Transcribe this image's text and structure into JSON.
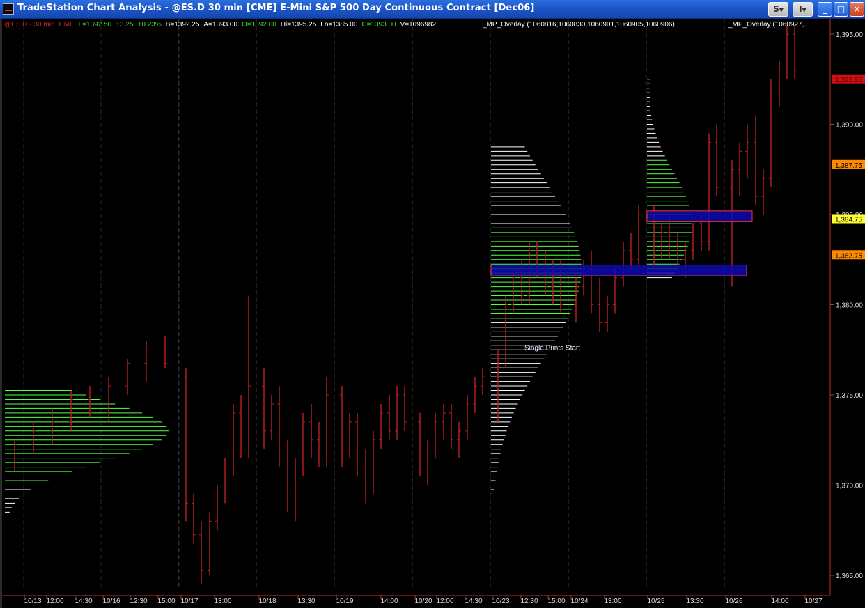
{
  "window": {
    "title": "TradeStation Chart Analysis - @ES.D  30 min  [CME] E-Mini S&P 500 Day Continuous Contract [Dec06]",
    "buttons": {
      "s_label": "S",
      "i_label": "I",
      "min": "_",
      "max": "□",
      "close": "×"
    }
  },
  "header": {
    "symbol": "@ES.D - 30 min",
    "exchange": "CME",
    "last": "L=1392.50",
    "change": "+3.25",
    "pct": "+0.23%",
    "bid": "B=1392.25",
    "ask": "A=1393.00",
    "open": "O=1392.00",
    "high": "Hi=1395.25",
    "low": "Lo=1385.00",
    "close": "C=1393.00",
    "volume": "V=1096982"
  },
  "overlays": [
    "_MP_Overlay  (1060816,1060830,1060901,1060905,1060906)",
    "_MP_Overlay  (1060927,..."
  ],
  "annotation": "Single Prints Start",
  "colors": {
    "up": "#44dd33",
    "down": "#cc2222",
    "bar": "#bb1f1f",
    "profile_green": "#55ff44",
    "profile_white": "#ffffff",
    "zone_fill": "#0b0bb0",
    "zone_border": "#ff3030",
    "axis": "#dddddd",
    "grid": "#555555"
  },
  "chart_data": {
    "type": "candlestick",
    "interval": "30 min",
    "ylim": [
      1364,
      1396
    ],
    "y_ticks": [
      "1,365.00",
      "1,370.00",
      "1,375.00",
      "1,380.00",
      "1,385.00",
      "1,390.00",
      "1,395.00"
    ],
    "x_ticks": [
      "10/13",
      "12:00",
      "14:30",
      "10/16",
      "12:30",
      "15:00",
      "10/17",
      "13:00",
      "10/18",
      "13:30",
      "10/19",
      "14:00",
      "10/20",
      "12:00",
      "14:30",
      "10/23",
      "12:30",
      "15:00",
      "10/24",
      "13:00",
      "10/25",
      "13:30",
      "10/26",
      "14:00",
      "10/27"
    ],
    "price_markers": [
      {
        "label": "1,392.50",
        "value": 1392.5,
        "bg": "#cc1111",
        "fg": "#660000"
      },
      {
        "label": "1,387.75",
        "value": 1387.75,
        "bg": "#ff8a00",
        "fg": "#000000"
      },
      {
        "label": "1,384.75",
        "value": 1384.75,
        "bg": "#ffff33",
        "fg": "#000000"
      },
      {
        "label": "1,382.75",
        "value": 1382.75,
        "bg": "#ff8a00",
        "fg": "#000000"
      }
    ],
    "zones": [
      {
        "name": "upper-value-zone",
        "from_day": "10/25",
        "to_day": "10/26",
        "low": 1384.6,
        "high": 1385.2
      },
      {
        "name": "lower-value-zone",
        "from_day": "10/23",
        "to_day": "10/26",
        "low": 1381.6,
        "high": 1382.2
      }
    ],
    "series": [
      {
        "day": "10/13",
        "values": [
          [
            1371.5,
            1372.5,
            1370.75,
            1372.25
          ],
          [
            1372.25,
            1373.5,
            1371.75,
            1373.0
          ],
          [
            1373.0,
            1374.25,
            1372.25,
            1373.5
          ],
          [
            1373.5,
            1375.25,
            1373.0,
            1374.75
          ],
          [
            1374.75,
            1375.5,
            1373.75,
            1374.0
          ],
          [
            1374.0,
            1376.0,
            1373.5,
            1375.5
          ],
          [
            1375.5,
            1377.0,
            1375.0,
            1376.75
          ],
          [
            1376.75,
            1378.0,
            1375.75,
            1377.5
          ],
          [
            1377.5,
            1378.25,
            1376.5,
            1376.75
          ]
        ]
      },
      {
        "day": "10/17",
        "values": [
          [
            1376.0,
            1376.5,
            1368.0,
            1369.0
          ],
          [
            1369.0,
            1369.5,
            1366.75,
            1367.25
          ],
          [
            1367.25,
            1368.0,
            1364.5,
            1365.25
          ],
          [
            1365.25,
            1368.5,
            1365.0,
            1368.0
          ],
          [
            1368.0,
            1370.0,
            1367.5,
            1369.5
          ],
          [
            1369.5,
            1371.5,
            1369.0,
            1371.0
          ],
          [
            1371.0,
            1374.5,
            1370.5,
            1374.0
          ],
          [
            1374.0,
            1375.0,
            1371.5,
            1372.0
          ],
          [
            1372.0,
            1380.5,
            1371.5,
            1375.5
          ]
        ]
      },
      {
        "day": "10/18",
        "values": [
          [
            1375.5,
            1376.5,
            1372.0,
            1373.0
          ],
          [
            1373.0,
            1375.0,
            1372.5,
            1374.5
          ],
          [
            1374.5,
            1375.5,
            1371.0,
            1371.5
          ],
          [
            1371.5,
            1372.5,
            1368.5,
            1369.5
          ],
          [
            1369.5,
            1371.5,
            1368.0,
            1371.0
          ],
          [
            1371.0,
            1374.0,
            1370.5,
            1373.5
          ],
          [
            1373.5,
            1374.5,
            1371.5,
            1372.5
          ],
          [
            1372.5,
            1373.5,
            1371.0,
            1371.5
          ],
          [
            1371.5,
            1376.0,
            1371.0,
            1375.0
          ]
        ]
      },
      {
        "day": "10/19",
        "values": [
          [
            1375.0,
            1375.5,
            1371.0,
            1372.0
          ],
          [
            1372.0,
            1374.0,
            1371.5,
            1373.5
          ],
          [
            1373.5,
            1374.0,
            1370.5,
            1371.0
          ],
          [
            1371.0,
            1372.0,
            1369.0,
            1370.0
          ],
          [
            1370.0,
            1373.0,
            1369.5,
            1372.5
          ],
          [
            1372.5,
            1374.5,
            1372.0,
            1374.0
          ],
          [
            1374.0,
            1375.0,
            1372.5,
            1373.0
          ],
          [
            1373.0,
            1375.5,
            1372.5,
            1375.0
          ],
          [
            1375.0,
            1375.5,
            1373.0,
            1373.5
          ]
        ]
      },
      {
        "day": "10/20",
        "values": [
          [
            1373.5,
            1374.0,
            1370.5,
            1371.0
          ],
          [
            1371.0,
            1372.5,
            1370.0,
            1372.0
          ],
          [
            1372.0,
            1374.0,
            1371.5,
            1373.5
          ],
          [
            1373.5,
            1374.5,
            1372.5,
            1374.0
          ],
          [
            1374.0,
            1374.5,
            1372.0,
            1372.5
          ],
          [
            1372.5,
            1373.5,
            1371.5,
            1373.0
          ],
          [
            1373.0,
            1375.0,
            1372.5,
            1374.5
          ],
          [
            1374.5,
            1376.0,
            1374.0,
            1375.5
          ],
          [
            1375.5,
            1376.5,
            1375.0,
            1376.0
          ]
        ]
      },
      {
        "day": "10/23",
        "values": [
          [
            1376.0,
            1377.5,
            1373.5,
            1377.0
          ],
          [
            1377.0,
            1380.5,
            1376.5,
            1380.0
          ],
          [
            1380.0,
            1382.0,
            1379.5,
            1381.5
          ],
          [
            1381.5,
            1382.5,
            1380.0,
            1380.5
          ],
          [
            1380.5,
            1383.5,
            1380.0,
            1383.0
          ],
          [
            1383.0,
            1383.5,
            1381.5,
            1382.0
          ],
          [
            1382.0,
            1383.0,
            1380.5,
            1381.0
          ],
          [
            1381.0,
            1382.5,
            1380.0,
            1382.0
          ],
          [
            1382.0,
            1382.5,
            1379.5,
            1380.0
          ]
        ]
      },
      {
        "day": "10/24",
        "values": [
          [
            1380.0,
            1381.5,
            1379.0,
            1381.0
          ],
          [
            1381.0,
            1382.5,
            1380.5,
            1382.0
          ],
          [
            1382.0,
            1383.0,
            1379.5,
            1380.0
          ],
          [
            1380.0,
            1381.5,
            1378.5,
            1379.0
          ],
          [
            1379.0,
            1380.5,
            1378.5,
            1380.0
          ],
          [
            1380.0,
            1382.0,
            1379.5,
            1381.5
          ],
          [
            1381.5,
            1383.5,
            1381.0,
            1383.0
          ],
          [
            1383.0,
            1384.0,
            1382.0,
            1382.5
          ],
          [
            1382.5,
            1385.5,
            1382.0,
            1385.0
          ]
        ]
      },
      {
        "day": "10/25",
        "values": [
          [
            1385.0,
            1385.5,
            1382.0,
            1383.0
          ],
          [
            1383.0,
            1384.5,
            1382.5,
            1384.0
          ],
          [
            1384.0,
            1385.0,
            1382.5,
            1383.0
          ],
          [
            1383.0,
            1384.0,
            1382.0,
            1382.5
          ],
          [
            1382.5,
            1383.5,
            1381.5,
            1383.0
          ],
          [
            1383.0,
            1384.5,
            1382.5,
            1384.5
          ],
          [
            1384.5,
            1385.0,
            1383.0,
            1383.5
          ],
          [
            1383.5,
            1389.5,
            1383.0,
            1389.0
          ],
          [
            1389.0,
            1390.0,
            1386.0,
            1386.5
          ]
        ]
      },
      {
        "day": "10/26",
        "values": [
          [
            1386.5,
            1388.0,
            1381.0,
            1387.5
          ],
          [
            1387.5,
            1389.0,
            1386.0,
            1388.5
          ],
          [
            1388.5,
            1390.0,
            1387.0,
            1389.0
          ],
          [
            1389.0,
            1390.5,
            1385.5,
            1386.0
          ],
          [
            1386.0,
            1387.5,
            1385.0,
            1387.0
          ],
          [
            1387.0,
            1392.5,
            1386.5,
            1392.0
          ],
          [
            1392.0,
            1393.5,
            1391.0,
            1393.0
          ],
          [
            1393.0,
            1395.5,
            1392.5,
            1395.0
          ],
          [
            1395.0,
            1395.5,
            1392.5,
            1393.0
          ]
        ]
      }
    ]
  }
}
